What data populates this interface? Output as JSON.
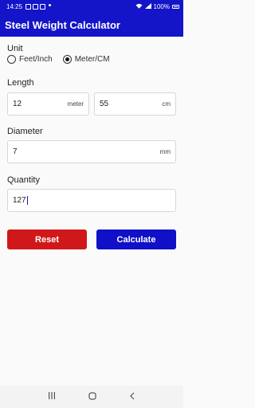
{
  "status_bar": {
    "time": "14:25",
    "battery": "100%"
  },
  "app": {
    "title": "Steel Weight Calculator"
  },
  "unit": {
    "label": "Unit",
    "options": [
      {
        "label": "Feet/Inch",
        "selected": false
      },
      {
        "label": "Meter/CM",
        "selected": true
      }
    ]
  },
  "length": {
    "label": "Length",
    "meter_value": "12",
    "meter_unit": "meter",
    "cm_value": "55",
    "cm_unit": "cm"
  },
  "diameter": {
    "label": "Diameter",
    "value": "7",
    "unit": "mm"
  },
  "quantity": {
    "label": "Quantity",
    "value": "127"
  },
  "buttons": {
    "reset": "Reset",
    "calculate": "Calculate"
  },
  "colors": {
    "primary": "#1414c8",
    "reset": "#d0181b"
  }
}
